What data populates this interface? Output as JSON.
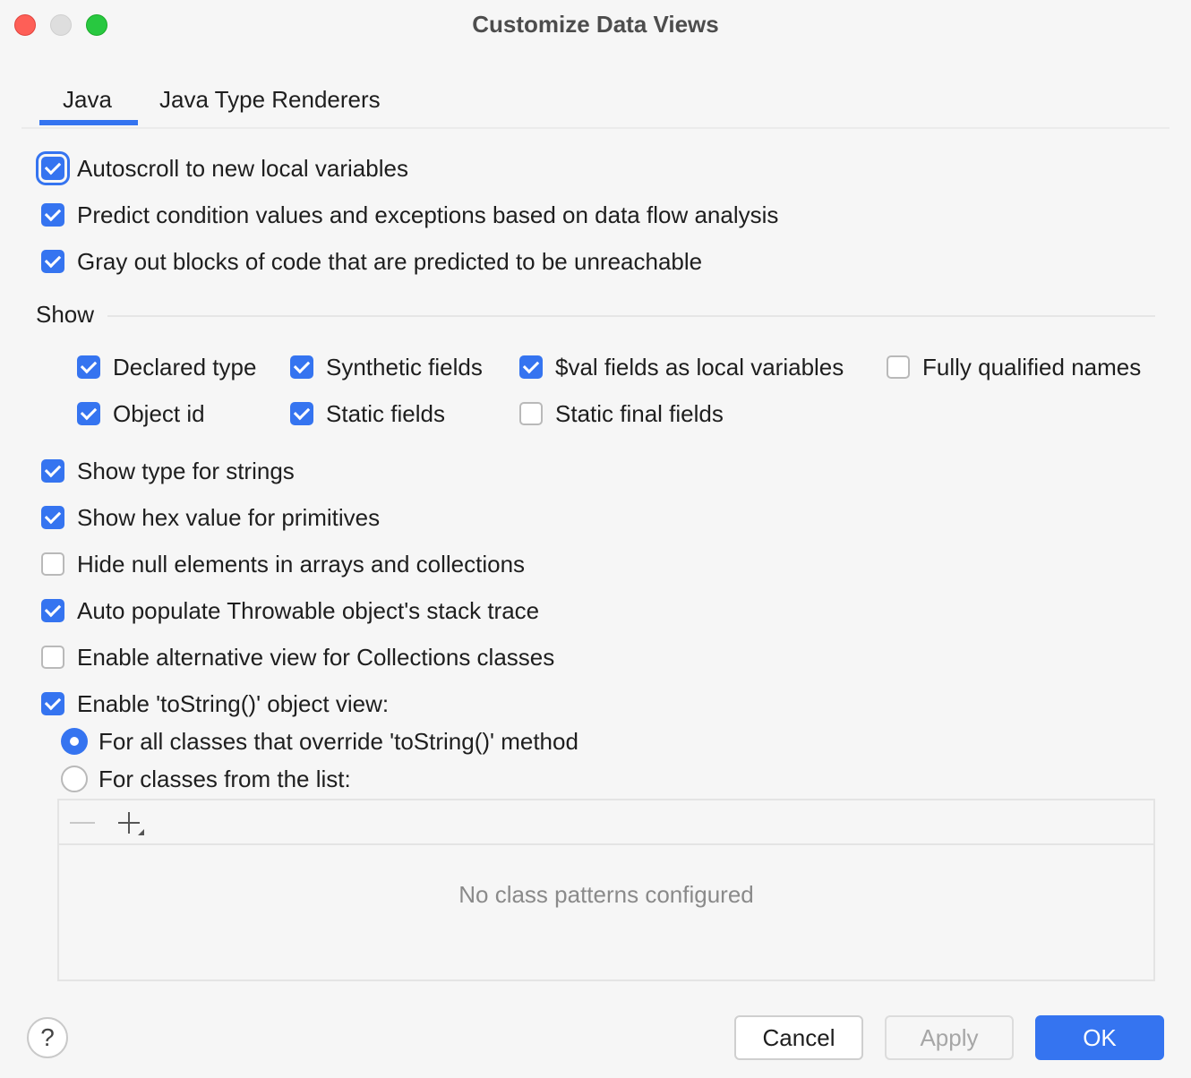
{
  "window": {
    "title": "Customize Data Views"
  },
  "tabs": [
    {
      "label": "Java",
      "selected": true
    },
    {
      "label": "Java Type Renderers",
      "selected": false
    }
  ],
  "options_top": [
    {
      "label": "Autoscroll to new local variables",
      "checked": true
    },
    {
      "label": "Predict condition values and exceptions based on data flow analysis",
      "checked": true
    },
    {
      "label": "Gray out blocks of code that are predicted to be unreachable",
      "checked": true
    }
  ],
  "show": {
    "label": "Show",
    "items": [
      {
        "label": "Declared type",
        "checked": true
      },
      {
        "label": "Synthetic fields",
        "checked": true
      },
      {
        "label": "$val fields as local variables",
        "checked": true
      },
      {
        "label": "Fully qualified names",
        "checked": false
      },
      {
        "label": "Object id",
        "checked": true
      },
      {
        "label": "Static fields",
        "checked": true
      },
      {
        "label": "Static final fields",
        "checked": false
      }
    ]
  },
  "options_bottom": [
    {
      "label": "Show type for strings",
      "checked": true
    },
    {
      "label": "Show hex value for primitives",
      "checked": true
    },
    {
      "label": "Hide null elements in arrays and collections",
      "checked": false
    },
    {
      "label": "Auto populate Throwable object's stack trace",
      "checked": true
    },
    {
      "label": "Enable alternative view for Collections classes",
      "checked": false
    },
    {
      "label": "Enable 'toString()' object view:",
      "checked": true
    }
  ],
  "tostring_mode": [
    {
      "label": "For all classes that override 'toString()' method",
      "selected": true
    },
    {
      "label": "For classes from the list:",
      "selected": false
    }
  ],
  "class_list": {
    "empty_text": "No class patterns configured"
  },
  "footer": {
    "help_label": "?",
    "cancel_label": "Cancel",
    "apply_label": "Apply",
    "ok_label": "OK"
  },
  "colors": {
    "accent": "#3574f0",
    "background": "#f6f6f6"
  },
  "icons": [
    "help-icon",
    "remove-icon",
    "add-icon"
  ]
}
